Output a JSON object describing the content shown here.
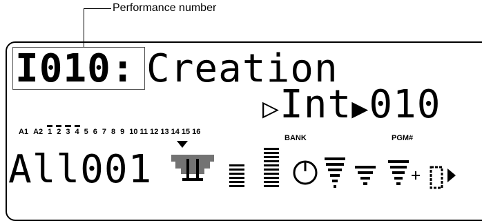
{
  "callout": {
    "label": "Performance number"
  },
  "display": {
    "performance_number": "I010:",
    "performance_name": "Creation",
    "bank_selector": "Int",
    "program_number": "010",
    "parts": [
      {
        "label": "A1",
        "on": false
      },
      {
        "label": "A2",
        "on": false
      },
      {
        "label": "1",
        "on": true
      },
      {
        "label": "2",
        "on": true
      },
      {
        "label": "3",
        "on": true
      },
      {
        "label": "4",
        "on": true
      },
      {
        "label": "5",
        "on": false
      },
      {
        "label": "6",
        "on": false
      },
      {
        "label": "7",
        "on": false
      },
      {
        "label": "8",
        "on": false
      },
      {
        "label": "9",
        "on": false
      },
      {
        "label": "10",
        "on": false
      },
      {
        "label": "11",
        "on": false
      },
      {
        "label": "12",
        "on": false
      },
      {
        "label": "13",
        "on": false
      },
      {
        "label": "14",
        "on": false
      },
      {
        "label": "15",
        "on": false
      },
      {
        "label": "16",
        "on": false
      }
    ],
    "bank_label": "BANK",
    "pgm_label": "PGM#",
    "bottom_value": "All001"
  },
  "icons": [
    "pan-icon",
    "arrow-down-icon",
    "level-meter-icon",
    "level-meter-icon",
    "knob-icon",
    "wave-icon",
    "wave-icon",
    "wave-icon",
    "plus-icon",
    "box-icon",
    "triangle-icon"
  ]
}
